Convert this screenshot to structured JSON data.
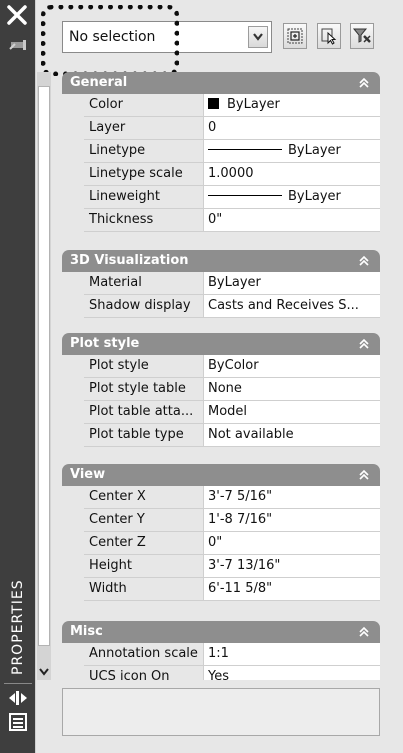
{
  "palette": {
    "title": "PROPERTIES"
  },
  "selection": {
    "value": "No selection"
  },
  "toolbar": {
    "toggle_pickadd_icon": "toggle-pickadd-icon",
    "select_objects_icon": "select-objects-icon",
    "quick_select_icon": "quick-select-icon"
  },
  "sections": {
    "general": {
      "title": "General",
      "rows": [
        {
          "label": "Color",
          "value": "ByLayer"
        },
        {
          "label": "Layer",
          "value": "0"
        },
        {
          "label": "Linetype",
          "value": "ByLayer"
        },
        {
          "label": "Linetype scale",
          "value": "1.0000"
        },
        {
          "label": "Lineweight",
          "value": "ByLayer"
        },
        {
          "label": "Thickness",
          "value": "0\""
        }
      ]
    },
    "viz3d": {
      "title": "3D Visualization",
      "rows": [
        {
          "label": "Material",
          "value": "ByLayer"
        },
        {
          "label": "Shadow display",
          "value": "Casts and Receives S..."
        }
      ]
    },
    "plot": {
      "title": "Plot style",
      "rows": [
        {
          "label": "Plot style",
          "value": "ByColor"
        },
        {
          "label": "Plot style table",
          "value": "None"
        },
        {
          "label": "Plot table atta...",
          "value": "Model"
        },
        {
          "label": "Plot table type",
          "value": "Not available"
        }
      ]
    },
    "view": {
      "title": "View",
      "rows": [
        {
          "label": "Center X",
          "value": "3'-7 5/16\""
        },
        {
          "label": "Center Y",
          "value": "1'-8 7/16\""
        },
        {
          "label": "Center Z",
          "value": "0\""
        },
        {
          "label": "Height",
          "value": "3'-7 13/16\""
        },
        {
          "label": "Width",
          "value": "6'-11 5/8\""
        }
      ]
    },
    "misc": {
      "title": "Misc",
      "rows": [
        {
          "label": "Annotation scale",
          "value": "1:1"
        },
        {
          "label": "UCS icon On",
          "value": "Yes"
        }
      ]
    }
  },
  "colors": {
    "strip": "#3e3e3e",
    "section_header": "#8e8e8e",
    "panel": "#e7e7e7"
  }
}
